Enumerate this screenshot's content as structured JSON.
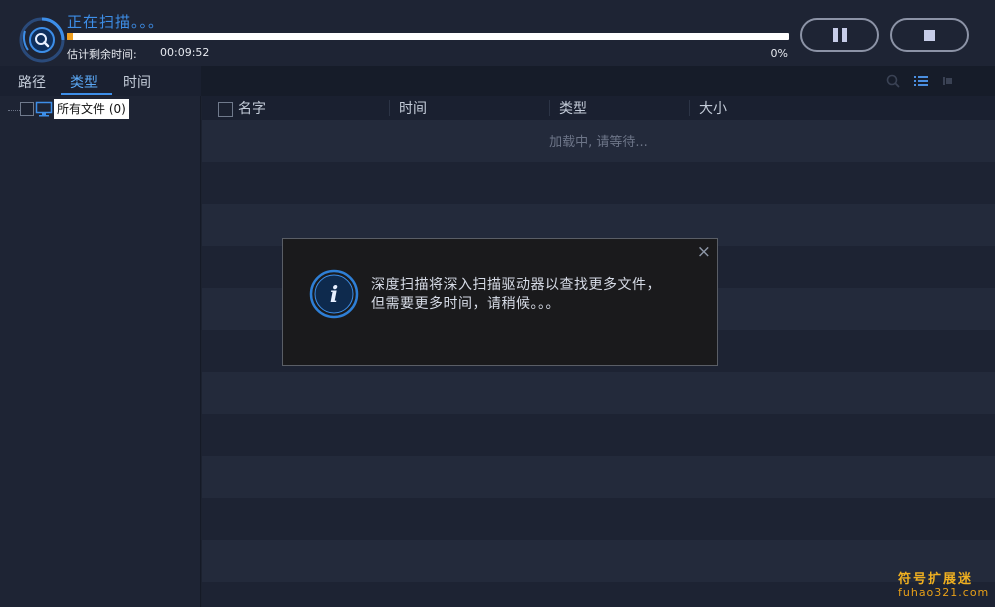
{
  "scan": {
    "title": "正在扫描。。。",
    "eta_label": "估计剩余时间:",
    "eta_value": "00:09:52",
    "progress_text": "0%",
    "progress_fraction": 0.008
  },
  "controls": {
    "pause_icon": "pause-icon",
    "stop_icon": "stop-icon"
  },
  "tabs": [
    {
      "label": "路径",
      "active": false
    },
    {
      "label": "类型",
      "active": true
    },
    {
      "label": "时间",
      "active": false
    }
  ],
  "toolbar": {
    "icons": [
      "search-icon",
      "list-view-icon",
      "detail-view-icon"
    ]
  },
  "tree": {
    "root_label": "所有文件 (0)",
    "root_icon": "monitor-icon"
  },
  "list": {
    "columns": [
      "名字",
      "时间",
      "类型",
      "大小"
    ],
    "loading_text": "加载中, 请等待..."
  },
  "dialog": {
    "message_line1": "深度扫描将深入扫描驱动器以查找更多文件，",
    "message_line2": "但需要更多时间，请稍候。。。",
    "close_label": "×",
    "icon": "info-icon"
  },
  "watermark": {
    "title": "符号扩展迷",
    "url": "fuhao321.com"
  },
  "colors": {
    "accent": "#3d8ee8",
    "progress_fill": "#f0a020",
    "background": "#1c2230",
    "dialog_bg": "#1a1a1c",
    "watermark": "#f0b020"
  }
}
